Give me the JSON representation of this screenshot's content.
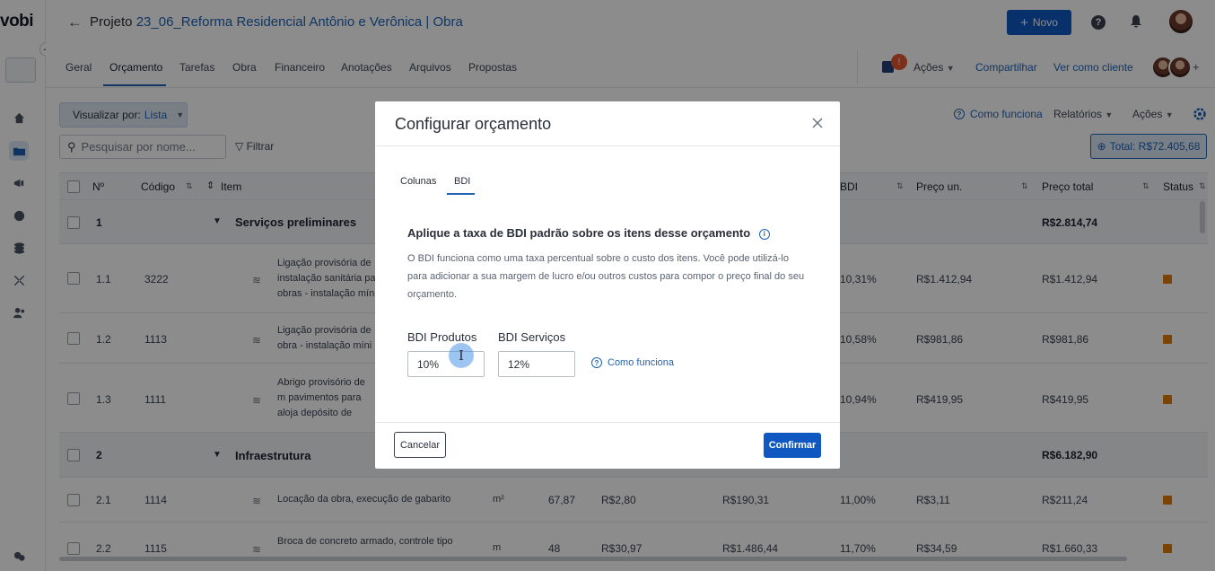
{
  "app": {
    "logo": "vobi"
  },
  "header": {
    "title_prefix": "Projeto",
    "project_name": "23_06_Reforma Residencial Antônio e Verônica | Obra",
    "new_button": "Novo",
    "help_icon": "?"
  },
  "tabs": [
    "Geral",
    "Orçamento",
    "Tarefas",
    "Obra",
    "Financeiro",
    "Anotações",
    "Arquivos",
    "Propostas"
  ],
  "tab_actions": {
    "badge": "!",
    "actions": "Ações",
    "share": "Compartilhar",
    "view_as_client": "Ver como cliente"
  },
  "toolbar": {
    "view_by_label": "Visualizar por:",
    "view_by_value": "Lista",
    "search_placeholder": "Pesquisar por nome...",
    "filter": "Filtrar",
    "how_it_works": "Como funciona",
    "reports": "Relatórios",
    "actions": "Ações",
    "total": "Total: R$72.405,68"
  },
  "table": {
    "headers": {
      "num": "Nº",
      "code": "Código",
      "item": "Item",
      "bdi": "BDI",
      "unit_price": "Preço un.",
      "total_price": "Preço total",
      "status": "Status"
    },
    "rows": [
      {
        "num": "1",
        "name": "Serviços preliminares",
        "total": "R$2.814,74",
        "group": true
      },
      {
        "num": "1.1",
        "code": "3222",
        "desc": "Ligação provisória de instalação sanitária pa obras - instalação mín",
        "bdi": "10,31%",
        "unit": "R$1.412,94",
        "total": "R$1.412,94"
      },
      {
        "num": "1.2",
        "code": "1113",
        "desc": "Ligação provisória de obra - instalação míni",
        "bdi": "10,58%",
        "unit": "R$981,86",
        "total": "R$981,86"
      },
      {
        "num": "1.3",
        "code": "1111",
        "desc": "Abrigo provisório de m pavimentos para aloja depósito de materiais",
        "bdi": "10,94%",
        "unit": "R$419,95",
        "total": "R$419,95"
      },
      {
        "num": "2",
        "name": "Infraestrutura",
        "total": "R$6.182,90",
        "group": true
      },
      {
        "num": "2.1",
        "code": "1114",
        "desc": "Locação da obra, execução de gabarito",
        "un": "m²",
        "qty": "67,87",
        "cost": "R$2,80",
        "subtotal": "R$190,31",
        "bdi": "11,00%",
        "unit": "R$3,11",
        "total": "R$211,24"
      },
      {
        "num": "2.2",
        "code": "1115",
        "desc": "Broca de concreto armado, controle tipo",
        "un": "m",
        "qty": "48",
        "cost": "R$30,97",
        "subtotal": "R$1.486,44",
        "bdi": "11,70%",
        "unit": "R$34,59",
        "total": "R$1.660,33"
      }
    ]
  },
  "modal": {
    "title": "Configurar orçamento",
    "tabs": [
      "Colunas",
      "BDI"
    ],
    "heading": "Aplique a taxa de BDI padrão sobre os itens desse orçamento",
    "paragraph": "O BDI funciona como uma taxa percentual sobre o custo dos itens. Você pode utilizá-lo para adicionar a sua margem de lucro e/ou outros custos para compor o preço final do seu orçamento.",
    "bdi_products_label": "BDI Produtos",
    "bdi_products_value": "10%",
    "bdi_services_label": "BDI Serviços",
    "bdi_services_value": "12%",
    "how_it_works": "Como funciona",
    "cancel": "Cancelar",
    "confirm": "Confirmar"
  },
  "colors": {
    "accent": "#0f58c1",
    "status": "#e07b08"
  }
}
